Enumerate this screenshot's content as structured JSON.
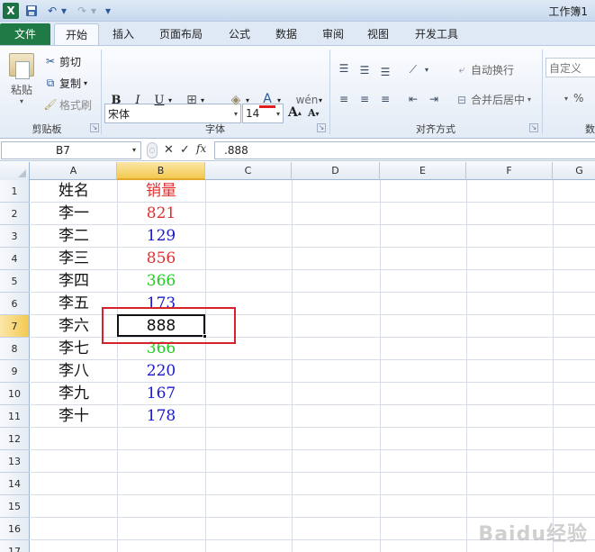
{
  "window": {
    "title": "工作簿1",
    "excel_logo": "X"
  },
  "quick_access": {
    "save_icon": "save-icon",
    "undo_icon": "undo-icon",
    "redo_icon": "redo-icon"
  },
  "tabs": [
    "文件",
    "开始",
    "插入",
    "页面布局",
    "公式",
    "数据",
    "审阅",
    "视图",
    "开发工具"
  ],
  "ribbon": {
    "clipboard": {
      "paste": "粘贴",
      "cut": "剪切",
      "copy": "复制",
      "format_painter": "格式刷",
      "group_label": "剪贴板"
    },
    "font": {
      "font_name": "宋体",
      "font_size": "14",
      "grow": "A",
      "shrink": "A",
      "bold": "B",
      "italic": "I",
      "underline": "U",
      "font_color": "A",
      "phonetic": "wén",
      "group_label": "字体"
    },
    "alignment": {
      "wrap_text": "自动换行",
      "merge_center": "合并后居中",
      "group_label": "对齐方式"
    },
    "number": {
      "format": "自定义",
      "percent": "%",
      "group_label": "数"
    }
  },
  "formula_bar": {
    "name_box": "B7",
    "fx": "fx",
    "cancel": "✕",
    "enter": "✓",
    "value": ".888"
  },
  "grid": {
    "columns": [
      "A",
      "B",
      "C",
      "D",
      "E",
      "F",
      "G"
    ],
    "active_column": "B",
    "rows": [
      "1",
      "2",
      "3",
      "4",
      "5",
      "6",
      "7",
      "8",
      "9",
      "10",
      "11",
      "12",
      "13",
      "14",
      "15",
      "16",
      "17"
    ],
    "active_row": "7",
    "data": [
      {
        "name": "姓名",
        "value": "销量",
        "color": "#e03030"
      },
      {
        "name": "李一",
        "value": "821",
        "color": "#e03030"
      },
      {
        "name": "李二",
        "value": "129",
        "color": "#1a1acc"
      },
      {
        "name": "李三",
        "value": "856",
        "color": "#e03030"
      },
      {
        "name": "李四",
        "value": "366",
        "color": "#22cc22"
      },
      {
        "name": "李五",
        "value": "173",
        "color": "#1a1acc"
      },
      {
        "name": "李六",
        "value": "888",
        "color": "#111111"
      },
      {
        "name": "李七",
        "value": "366",
        "color": "#22cc22"
      },
      {
        "name": "李八",
        "value": "220",
        "color": "#1a1acc"
      },
      {
        "name": "李九",
        "value": "167",
        "color": "#1a1acc"
      },
      {
        "name": "李十",
        "value": "178",
        "color": "#1a1acc"
      }
    ]
  },
  "watermark": "Baidu经验"
}
